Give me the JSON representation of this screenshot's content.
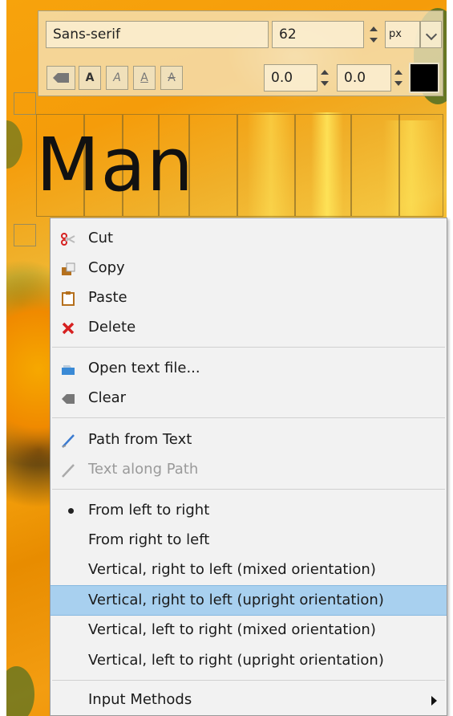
{
  "toolbar": {
    "font_name": "Sans-serif",
    "font_size": "62",
    "unit": "px",
    "line_spacing": "0.0",
    "letter_spacing": "0.0",
    "text_color": "#000000",
    "format_buttons": [
      "clear-format",
      "bold",
      "italic",
      "underline",
      "strikethrough"
    ]
  },
  "canvas": {
    "text": "Man"
  },
  "context_menu": {
    "items": [
      {
        "label": "Cut",
        "icon": "scissors-icon"
      },
      {
        "label": "Copy",
        "icon": "copy-icon"
      },
      {
        "label": "Paste",
        "icon": "paste-icon"
      },
      {
        "label": "Delete",
        "icon": "delete-icon"
      },
      {
        "label": "Open text file...",
        "icon": "open-file-icon"
      },
      {
        "label": "Clear",
        "icon": "eraser-icon"
      },
      {
        "label": "Path from Text",
        "icon": "path-icon"
      },
      {
        "label": "Text along Path",
        "icon": "path-icon",
        "disabled": true
      },
      {
        "label": "From left to right",
        "selected": true
      },
      {
        "label": "From right to left"
      },
      {
        "label": "Vertical, right to left (mixed orientation)"
      },
      {
        "label": "Vertical, right to left (upright orientation)",
        "highlighted": true
      },
      {
        "label": "Vertical, left to right (mixed orientation)"
      },
      {
        "label": "Vertical, left to right (upright orientation)"
      },
      {
        "label": "Input Methods",
        "submenu": true
      }
    ]
  },
  "colors": {
    "menu_highlight": "#a8d0ef",
    "menu_background": "#f2f2f2",
    "delete_red": "#d62020"
  }
}
